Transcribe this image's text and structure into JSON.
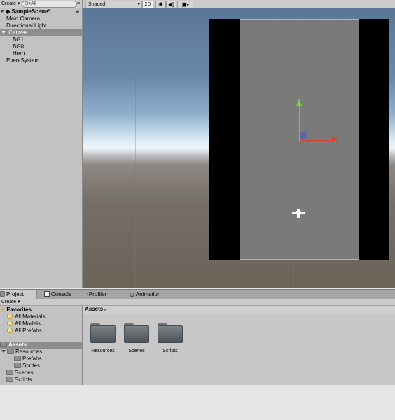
{
  "hierarchy": {
    "create_label": "Create",
    "search_placeholder": "Q▾All",
    "scene_name": "SampleScene*",
    "items": [
      {
        "label": "Main Camera"
      },
      {
        "label": "Directional Light"
      },
      {
        "label": "Canvas"
      },
      {
        "label": "BG1"
      },
      {
        "label": "BG0"
      },
      {
        "label": "Hero"
      },
      {
        "label": "EventSystem"
      }
    ]
  },
  "scene_toolbar": {
    "shading": "Shaded",
    "mode_2d": "2D"
  },
  "tabs": [
    {
      "label": "Project",
      "icon": "folder-icon"
    },
    {
      "label": "Console",
      "icon": "console-icon"
    },
    {
      "label": "Profiler",
      "icon": "profiler-icon"
    },
    {
      "label": "Animation",
      "icon": "animation-icon"
    }
  ],
  "project": {
    "create_label": "Create",
    "favorites": {
      "label": "Favorites",
      "items": [
        "All Materials",
        "All Models",
        "All Prefabs"
      ]
    },
    "assets_tree": {
      "label": "Assets",
      "items": [
        "Resources",
        "Prefabs",
        "Sprites",
        "Scenes",
        "Scripts"
      ]
    },
    "breadcrumb": "Assets",
    "breadcrumb_arrow": "▸",
    "assets": [
      "Resources",
      "Scenes",
      "Scripts"
    ]
  },
  "colors": {
    "selection": "#8e8e8e",
    "axis_y": "#7ad030",
    "axis_x": "#e0402a",
    "canvas_gray": "#7a7a7a"
  }
}
